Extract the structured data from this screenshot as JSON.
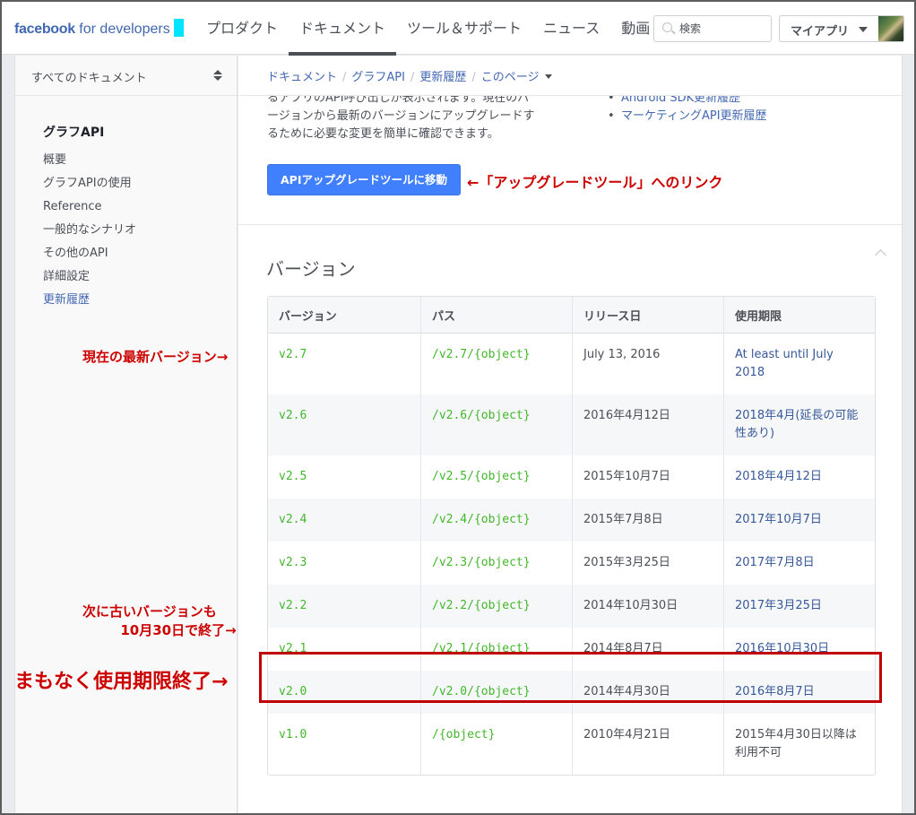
{
  "header": {
    "logo_brand": "facebook",
    "logo_suffix": "for developers",
    "nav": [
      {
        "label": "プロダクト",
        "active": false
      },
      {
        "label": "ドキュメント",
        "active": true
      },
      {
        "label": "ツール＆サポート",
        "active": false
      },
      {
        "label": "ニュース",
        "active": false
      },
      {
        "label": "動画",
        "active": false
      }
    ],
    "search_placeholder": "検索",
    "my_apps_label": "マイアプリ"
  },
  "sidebar": {
    "select_label": "すべてのドキュメント",
    "section_title": "グラフAPI",
    "items": [
      {
        "label": "概要"
      },
      {
        "label": "グラフAPIの使用"
      },
      {
        "label": "Reference"
      },
      {
        "label": "一般的なシナリオ"
      },
      {
        "label": "その他のAPI"
      },
      {
        "label": "詳細設定"
      },
      {
        "label": "更新履歴",
        "active": true
      }
    ]
  },
  "breadcrumb": [
    "ドキュメント",
    "グラフAPI",
    "更新履歴",
    "このページ"
  ],
  "main": {
    "intro_lines": [
      "るアプリのAPI呼び出しが表示されます。現在のバ",
      "ージョンから最新のバージョンにアップグレードす",
      "るために必要な変更を簡単に確認できます。"
    ],
    "links": [
      "Android SDK更新履歴",
      "マーケティングAPI更新履歴"
    ],
    "upgrade_button": "APIアップグレードツールに移動",
    "section_title": "バージョン",
    "table": {
      "headers": [
        "バージョン",
        "パス",
        "リリース日",
        "使用期限"
      ],
      "rows": [
        {
          "version": "v2.7",
          "path": "/v2.7/{object}",
          "release": "July 13, 2016",
          "expires": "At least until July 2018"
        },
        {
          "version": "v2.6",
          "path": "/v2.6/{object}",
          "release": "2016年4月12日",
          "expires": "2018年4月(延長の可能性あり)"
        },
        {
          "version": "v2.5",
          "path": "/v2.5/{object}",
          "release": "2015年10月7日",
          "expires": "2018年4月12日"
        },
        {
          "version": "v2.4",
          "path": "/v2.4/{object}",
          "release": "2015年7月8日",
          "expires": "2017年10月7日"
        },
        {
          "version": "v2.3",
          "path": "/v2.3/{object}",
          "release": "2015年3月25日",
          "expires": "2017年7月8日"
        },
        {
          "version": "v2.2",
          "path": "/v2.2/{object}",
          "release": "2014年10月30日",
          "expires": "2017年3月25日"
        },
        {
          "version": "v2.1",
          "path": "/v2.1/{object}",
          "release": "2014年8月7日",
          "expires": "2016年10月30日"
        },
        {
          "version": "v2.0",
          "path": "/v2.0/{object}",
          "release": "2014年4月30日",
          "expires": "2016年8月7日"
        },
        {
          "version": "v1.0",
          "path": "/{object}",
          "release": "2010年4月21日",
          "expires": "2015年4月30日以降は利用不可",
          "expires_plain": true
        }
      ]
    }
  },
  "annotations": {
    "upgrade_link": "←「アップグレードツール」へのリンク",
    "latest": "現在の最新バージョン→",
    "next_line1": "次に古いバージョンも",
    "next_line2": "10月30日で終了→",
    "soon": "まもなく使用期限終了→"
  },
  "colors": {
    "brand_blue": "#4267b2",
    "button_blue": "#4080ff",
    "code_green": "#42b72a",
    "annotation_red": "#cc0000"
  }
}
